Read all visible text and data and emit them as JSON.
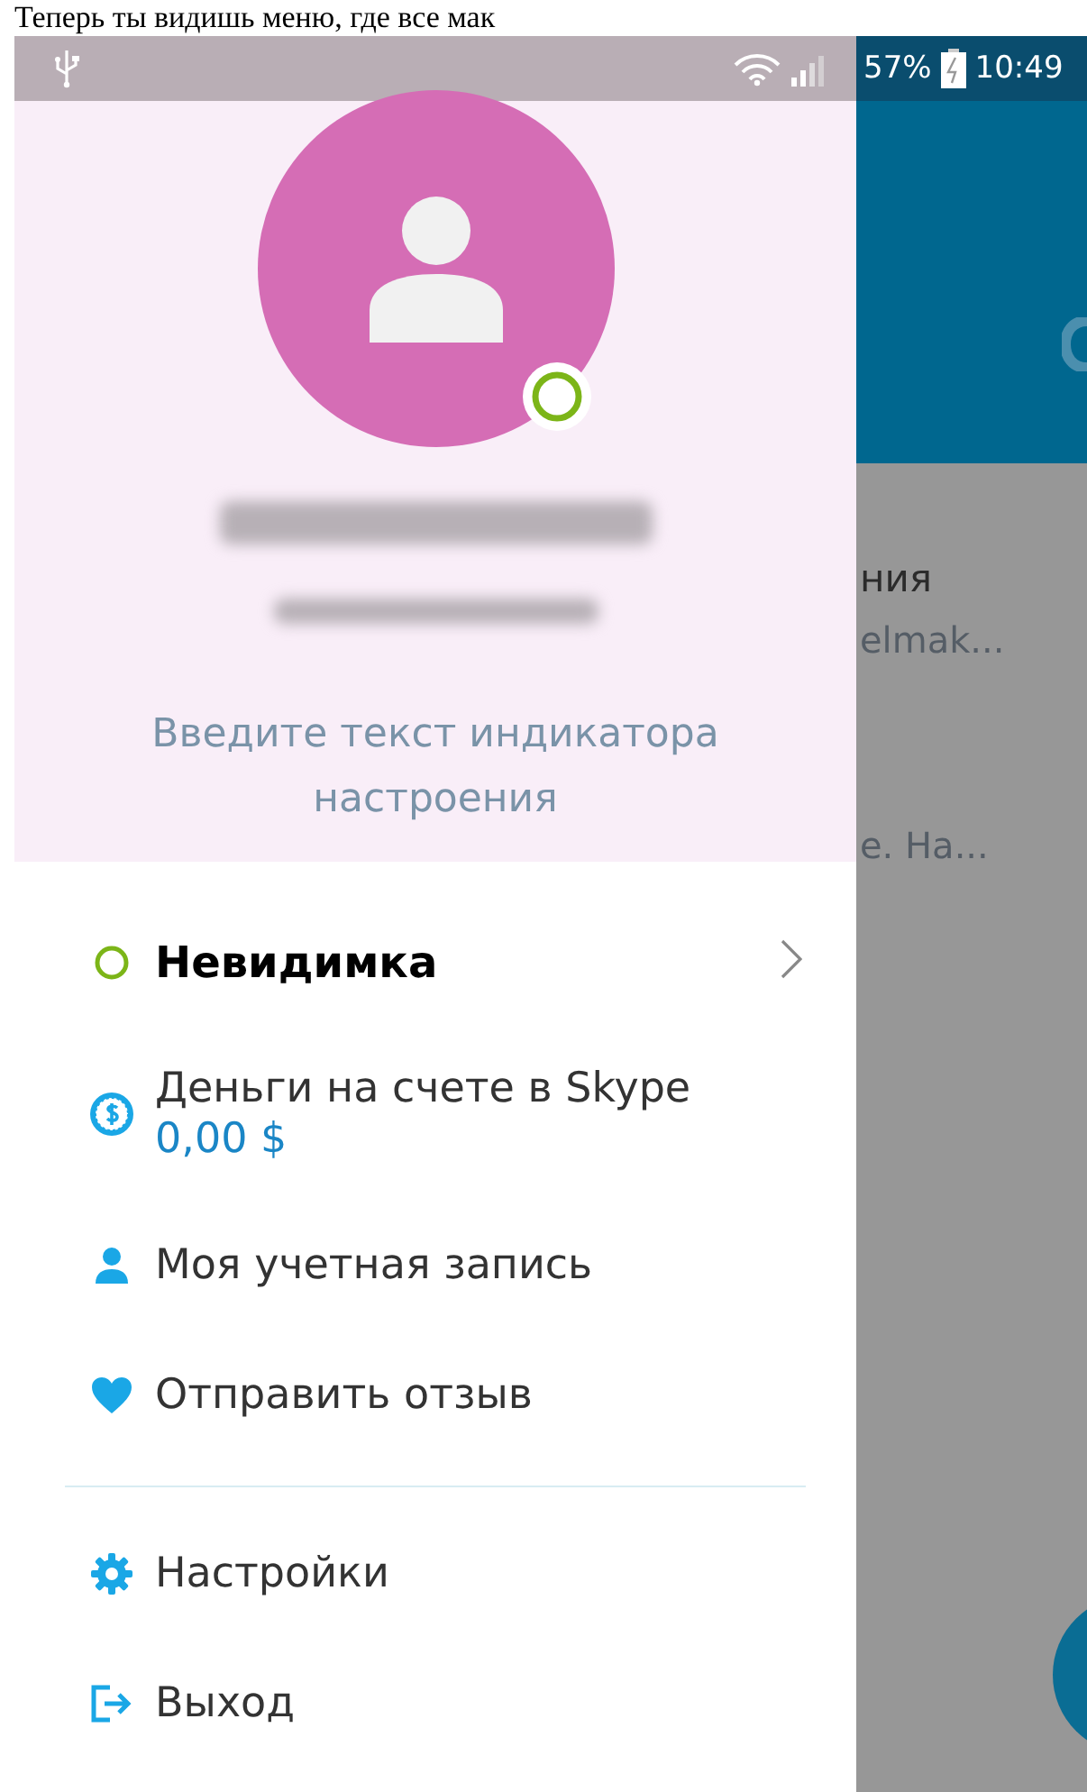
{
  "caption": "Теперь ты видишь меню, где все мак",
  "status_bar": {
    "battery": "57%",
    "time": "10:49"
  },
  "background_app": {
    "texts": [
      {
        "kind": "title",
        "text": "ния"
      },
      {
        "kind": "subtitle",
        "text": "elmak..."
      },
      {
        "kind": "subtitle",
        "text": "е. На..."
      }
    ]
  },
  "profile": {
    "mood_placeholder": "Введите текст индикатора настроения"
  },
  "menu": {
    "groups": [
      [
        {
          "kind": "status",
          "label": "Невидимка"
        },
        {
          "kind": "balance",
          "label": "Деньги на счете в Skype",
          "value": "0,00 $"
        },
        {
          "kind": "account",
          "label": "Моя учетная запись"
        },
        {
          "kind": "feedback",
          "label": "Отправить отзыв"
        }
      ],
      [
        {
          "kind": "settings",
          "label": "Настройки"
        },
        {
          "kind": "logout",
          "label": "Выход"
        }
      ]
    ]
  }
}
